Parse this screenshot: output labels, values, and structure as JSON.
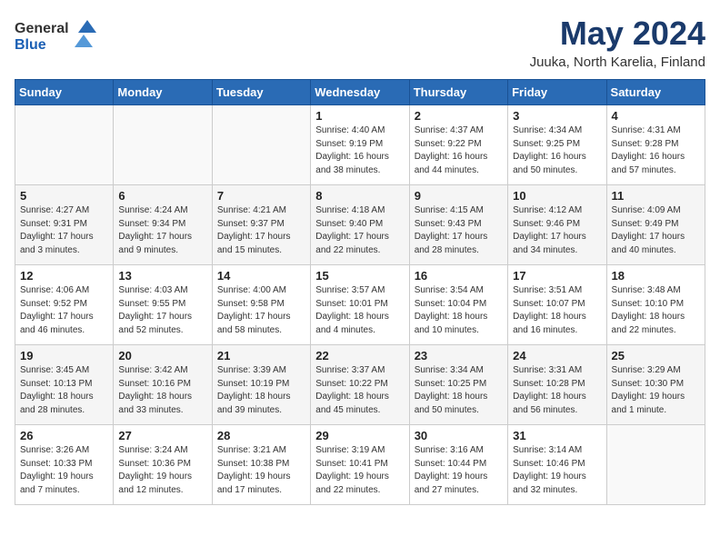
{
  "header": {
    "logo_general": "General",
    "logo_blue": "Blue",
    "month": "May 2024",
    "location": "Juuka, North Karelia, Finland"
  },
  "days_of_week": [
    "Sunday",
    "Monday",
    "Tuesday",
    "Wednesday",
    "Thursday",
    "Friday",
    "Saturday"
  ],
  "weeks": [
    [
      {
        "day": "",
        "info": ""
      },
      {
        "day": "",
        "info": ""
      },
      {
        "day": "",
        "info": ""
      },
      {
        "day": "1",
        "info": "Sunrise: 4:40 AM\nSunset: 9:19 PM\nDaylight: 16 hours\nand 38 minutes."
      },
      {
        "day": "2",
        "info": "Sunrise: 4:37 AM\nSunset: 9:22 PM\nDaylight: 16 hours\nand 44 minutes."
      },
      {
        "day": "3",
        "info": "Sunrise: 4:34 AM\nSunset: 9:25 PM\nDaylight: 16 hours\nand 50 minutes."
      },
      {
        "day": "4",
        "info": "Sunrise: 4:31 AM\nSunset: 9:28 PM\nDaylight: 16 hours\nand 57 minutes."
      }
    ],
    [
      {
        "day": "5",
        "info": "Sunrise: 4:27 AM\nSunset: 9:31 PM\nDaylight: 17 hours\nand 3 minutes."
      },
      {
        "day": "6",
        "info": "Sunrise: 4:24 AM\nSunset: 9:34 PM\nDaylight: 17 hours\nand 9 minutes."
      },
      {
        "day": "7",
        "info": "Sunrise: 4:21 AM\nSunset: 9:37 PM\nDaylight: 17 hours\nand 15 minutes."
      },
      {
        "day": "8",
        "info": "Sunrise: 4:18 AM\nSunset: 9:40 PM\nDaylight: 17 hours\nand 22 minutes."
      },
      {
        "day": "9",
        "info": "Sunrise: 4:15 AM\nSunset: 9:43 PM\nDaylight: 17 hours\nand 28 minutes."
      },
      {
        "day": "10",
        "info": "Sunrise: 4:12 AM\nSunset: 9:46 PM\nDaylight: 17 hours\nand 34 minutes."
      },
      {
        "day": "11",
        "info": "Sunrise: 4:09 AM\nSunset: 9:49 PM\nDaylight: 17 hours\nand 40 minutes."
      }
    ],
    [
      {
        "day": "12",
        "info": "Sunrise: 4:06 AM\nSunset: 9:52 PM\nDaylight: 17 hours\nand 46 minutes."
      },
      {
        "day": "13",
        "info": "Sunrise: 4:03 AM\nSunset: 9:55 PM\nDaylight: 17 hours\nand 52 minutes."
      },
      {
        "day": "14",
        "info": "Sunrise: 4:00 AM\nSunset: 9:58 PM\nDaylight: 17 hours\nand 58 minutes."
      },
      {
        "day": "15",
        "info": "Sunrise: 3:57 AM\nSunset: 10:01 PM\nDaylight: 18 hours\nand 4 minutes."
      },
      {
        "day": "16",
        "info": "Sunrise: 3:54 AM\nSunset: 10:04 PM\nDaylight: 18 hours\nand 10 minutes."
      },
      {
        "day": "17",
        "info": "Sunrise: 3:51 AM\nSunset: 10:07 PM\nDaylight: 18 hours\nand 16 minutes."
      },
      {
        "day": "18",
        "info": "Sunrise: 3:48 AM\nSunset: 10:10 PM\nDaylight: 18 hours\nand 22 minutes."
      }
    ],
    [
      {
        "day": "19",
        "info": "Sunrise: 3:45 AM\nSunset: 10:13 PM\nDaylight: 18 hours\nand 28 minutes."
      },
      {
        "day": "20",
        "info": "Sunrise: 3:42 AM\nSunset: 10:16 PM\nDaylight: 18 hours\nand 33 minutes."
      },
      {
        "day": "21",
        "info": "Sunrise: 3:39 AM\nSunset: 10:19 PM\nDaylight: 18 hours\nand 39 minutes."
      },
      {
        "day": "22",
        "info": "Sunrise: 3:37 AM\nSunset: 10:22 PM\nDaylight: 18 hours\nand 45 minutes."
      },
      {
        "day": "23",
        "info": "Sunrise: 3:34 AM\nSunset: 10:25 PM\nDaylight: 18 hours\nand 50 minutes."
      },
      {
        "day": "24",
        "info": "Sunrise: 3:31 AM\nSunset: 10:28 PM\nDaylight: 18 hours\nand 56 minutes."
      },
      {
        "day": "25",
        "info": "Sunrise: 3:29 AM\nSunset: 10:30 PM\nDaylight: 19 hours\nand 1 minute."
      }
    ],
    [
      {
        "day": "26",
        "info": "Sunrise: 3:26 AM\nSunset: 10:33 PM\nDaylight: 19 hours\nand 7 minutes."
      },
      {
        "day": "27",
        "info": "Sunrise: 3:24 AM\nSunset: 10:36 PM\nDaylight: 19 hours\nand 12 minutes."
      },
      {
        "day": "28",
        "info": "Sunrise: 3:21 AM\nSunset: 10:38 PM\nDaylight: 19 hours\nand 17 minutes."
      },
      {
        "day": "29",
        "info": "Sunrise: 3:19 AM\nSunset: 10:41 PM\nDaylight: 19 hours\nand 22 minutes."
      },
      {
        "day": "30",
        "info": "Sunrise: 3:16 AM\nSunset: 10:44 PM\nDaylight: 19 hours\nand 27 minutes."
      },
      {
        "day": "31",
        "info": "Sunrise: 3:14 AM\nSunset: 10:46 PM\nDaylight: 19 hours\nand 32 minutes."
      },
      {
        "day": "",
        "info": ""
      }
    ]
  ]
}
